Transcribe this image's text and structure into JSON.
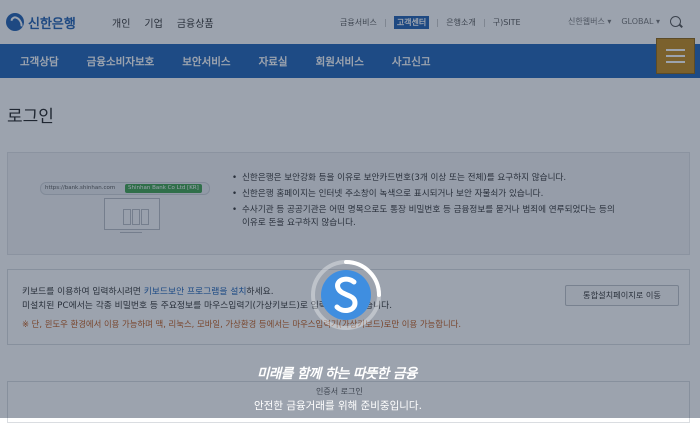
{
  "brand": {
    "name": "신한은행"
  },
  "top_menu": [
    "개인",
    "기업",
    "금융상품"
  ],
  "utility_links": [
    {
      "label": "금융서비스",
      "active": false
    },
    {
      "label": "고객센터",
      "active": true
    },
    {
      "label": "은행소개",
      "active": false
    },
    {
      "label": "구)SITE",
      "active": false
    }
  ],
  "right_links": {
    "family": "신한웹버스 ▾",
    "global": "GLOBAL ▾"
  },
  "nav": [
    "고객상담",
    "금융소비자보호",
    "보안서비스",
    "자료실",
    "회원서비스",
    "사고신고"
  ],
  "page_title": "로그인",
  "security_illustration": {
    "url": "https://bank.shinhan.com",
    "cert": "Shinhan Bank Co Ltd [KR]"
  },
  "security_notices": [
    "신한은행은 보안강화 등을 이유로 보안카드번호(3개 이상 또는 전체)를 요구하지 않습니다.",
    "신한은행 홈페이지는 인터넷 주소창이 녹색으로 표시되거나 보안 자물쇠가 있습니다.",
    "수사기관 등 공공기관은 어떤 명목으로도 통장 비밀번호 등 금융정보를 묻거나 범죄에 연루되었다는 등의",
    "이유로 돈을 요구하지 않습니다."
  ],
  "keyboard_security": {
    "line1_prefix": "키보드를 이용하여 입력하시려면 ",
    "line1_link": "키보드보안 프로그램을 설치",
    "line1_suffix": "하세요.",
    "line2": "미설치된 PC에서는 각종 비밀번호 등 주요정보를 마우스입력기(가상키보드)로 입력하실 수 있습니다.",
    "line3": "※ 단, 윈도우 환경에서 이용 가능하며 맥, 리눅스, 모바일, 가상환경 등에서는 마우스입력기(가상키보드)로만 이용 가능합니다.",
    "install_button": "통합설치페이지로 이동"
  },
  "bottom_text": "인증서 로그인",
  "overlay": {
    "slogan": "미래를 함께 하는 따뜻한 금융",
    "loading_message": "안전한 금융거래를 위해 준비중입니다."
  },
  "colors": {
    "brand_blue": "#1f63b6",
    "menu_gold": "#c58a1a",
    "warning": "#c05a1a"
  }
}
